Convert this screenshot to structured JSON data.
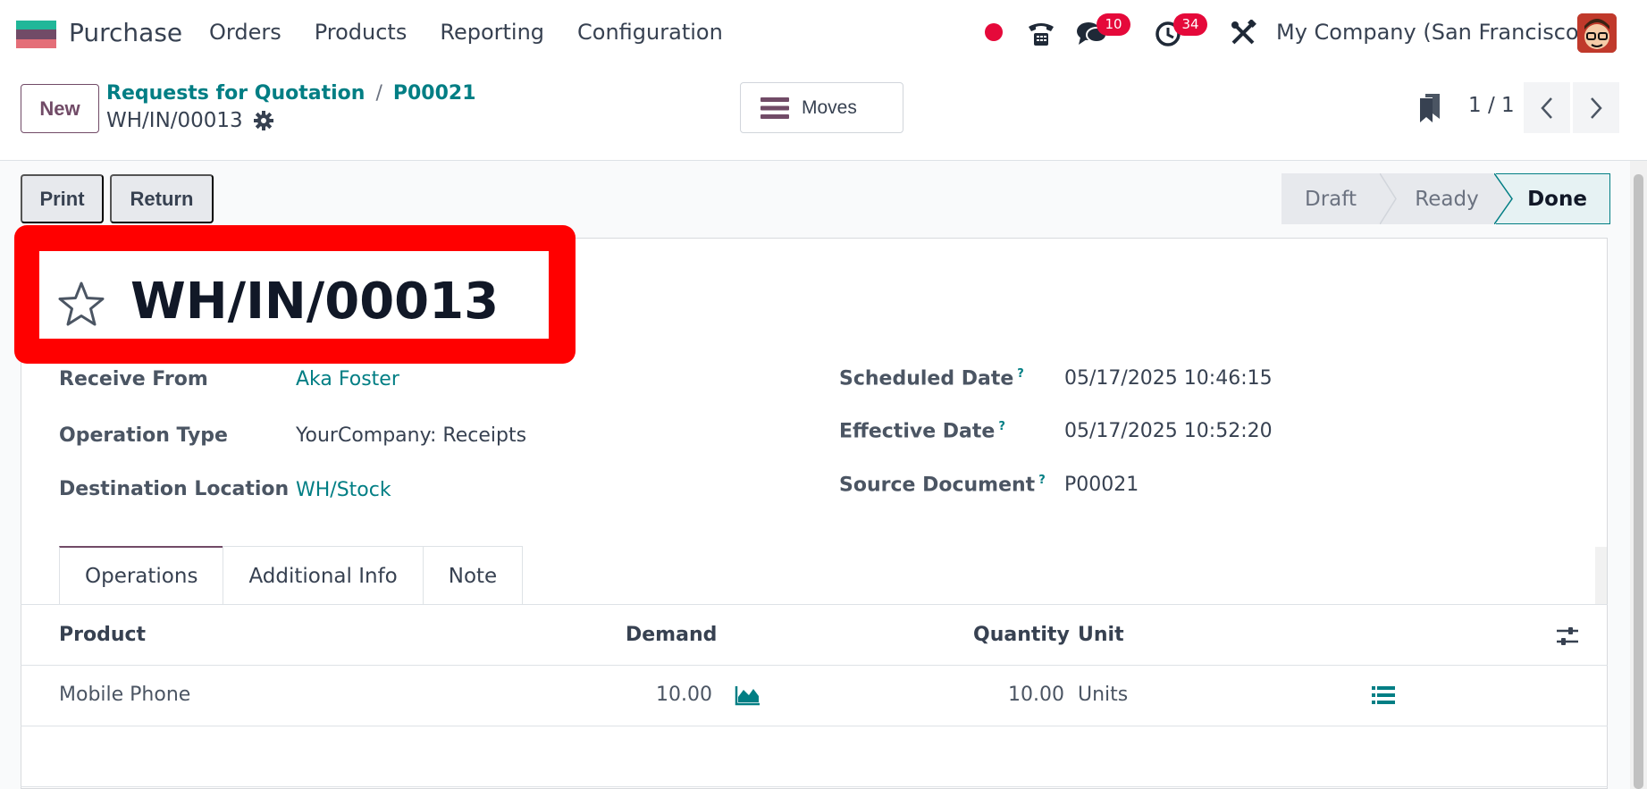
{
  "navbar": {
    "app_name": "Purchase",
    "menu": [
      "Orders",
      "Products",
      "Reporting",
      "Configuration"
    ],
    "messages_count": "10",
    "activities_count": "34",
    "company": "My Company (San Francisco)",
    "accent_color": "#714b67"
  },
  "control": {
    "new_label": "New",
    "breadcrumb": [
      "Requests for Quotation",
      "P00021"
    ],
    "breadcrumb_sep": "/",
    "record_name": "WH/IN/00013",
    "moves_label": "Moves",
    "pager": "1 / 1"
  },
  "actions": {
    "print_label": "Print",
    "return_label": "Return"
  },
  "status": {
    "steps": [
      "Draft",
      "Ready",
      "Done"
    ],
    "current": "Done"
  },
  "form": {
    "title": "WH/IN/00013",
    "receive_from_label": "Receive From",
    "receive_from": "Aka Foster",
    "operation_type_label": "Operation Type",
    "operation_type": "YourCompany: Receipts",
    "destination_label": "Destination Location",
    "destination": "WH/Stock",
    "scheduled_date_label": "Scheduled Date",
    "scheduled_date": "05/17/2025 10:46:15",
    "effective_date_label": "Effective Date",
    "effective_date": "05/17/2025 10:52:20",
    "source_document_label": "Source Document",
    "source_document": "P00021",
    "help_mark": "?"
  },
  "tabs": [
    "Operations",
    "Additional Info",
    "Note"
  ],
  "table": {
    "headers": {
      "product": "Product",
      "demand": "Demand",
      "quantity": "Quantity",
      "unit": "Unit"
    },
    "rows": [
      {
        "product": "Mobile Phone",
        "demand": "10.00",
        "quantity": "10.00",
        "unit": "Units"
      }
    ]
  }
}
